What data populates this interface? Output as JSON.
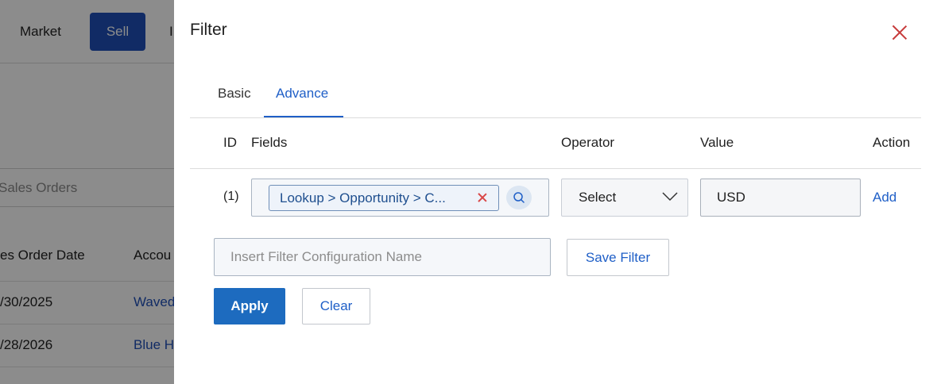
{
  "background": {
    "nav": {
      "market": "Market",
      "sell": "Sell",
      "extra": "I"
    },
    "search_placeholder": "Sales Orders",
    "columns": [
      "es Order Date",
      "Accou"
    ],
    "rows": [
      {
        "date": "/30/2025",
        "account": "Waved"
      },
      {
        "date": "/28/2026",
        "account": "Blue H"
      }
    ]
  },
  "modal": {
    "title": "Filter",
    "tabs": {
      "basic": "Basic",
      "advance": "Advance"
    },
    "headers": {
      "id": "ID",
      "fields": "Fields",
      "operator": "Operator",
      "value": "Value",
      "action": "Action"
    },
    "row": {
      "id": "(1)",
      "field_chip": "Lookup > Opportunity > C...",
      "operator": "Select",
      "value": "USD",
      "action": "Add"
    },
    "config_placeholder": "Insert Filter Configuration Name",
    "save_filter": "Save Filter",
    "apply": "Apply",
    "clear": "Clear"
  }
}
